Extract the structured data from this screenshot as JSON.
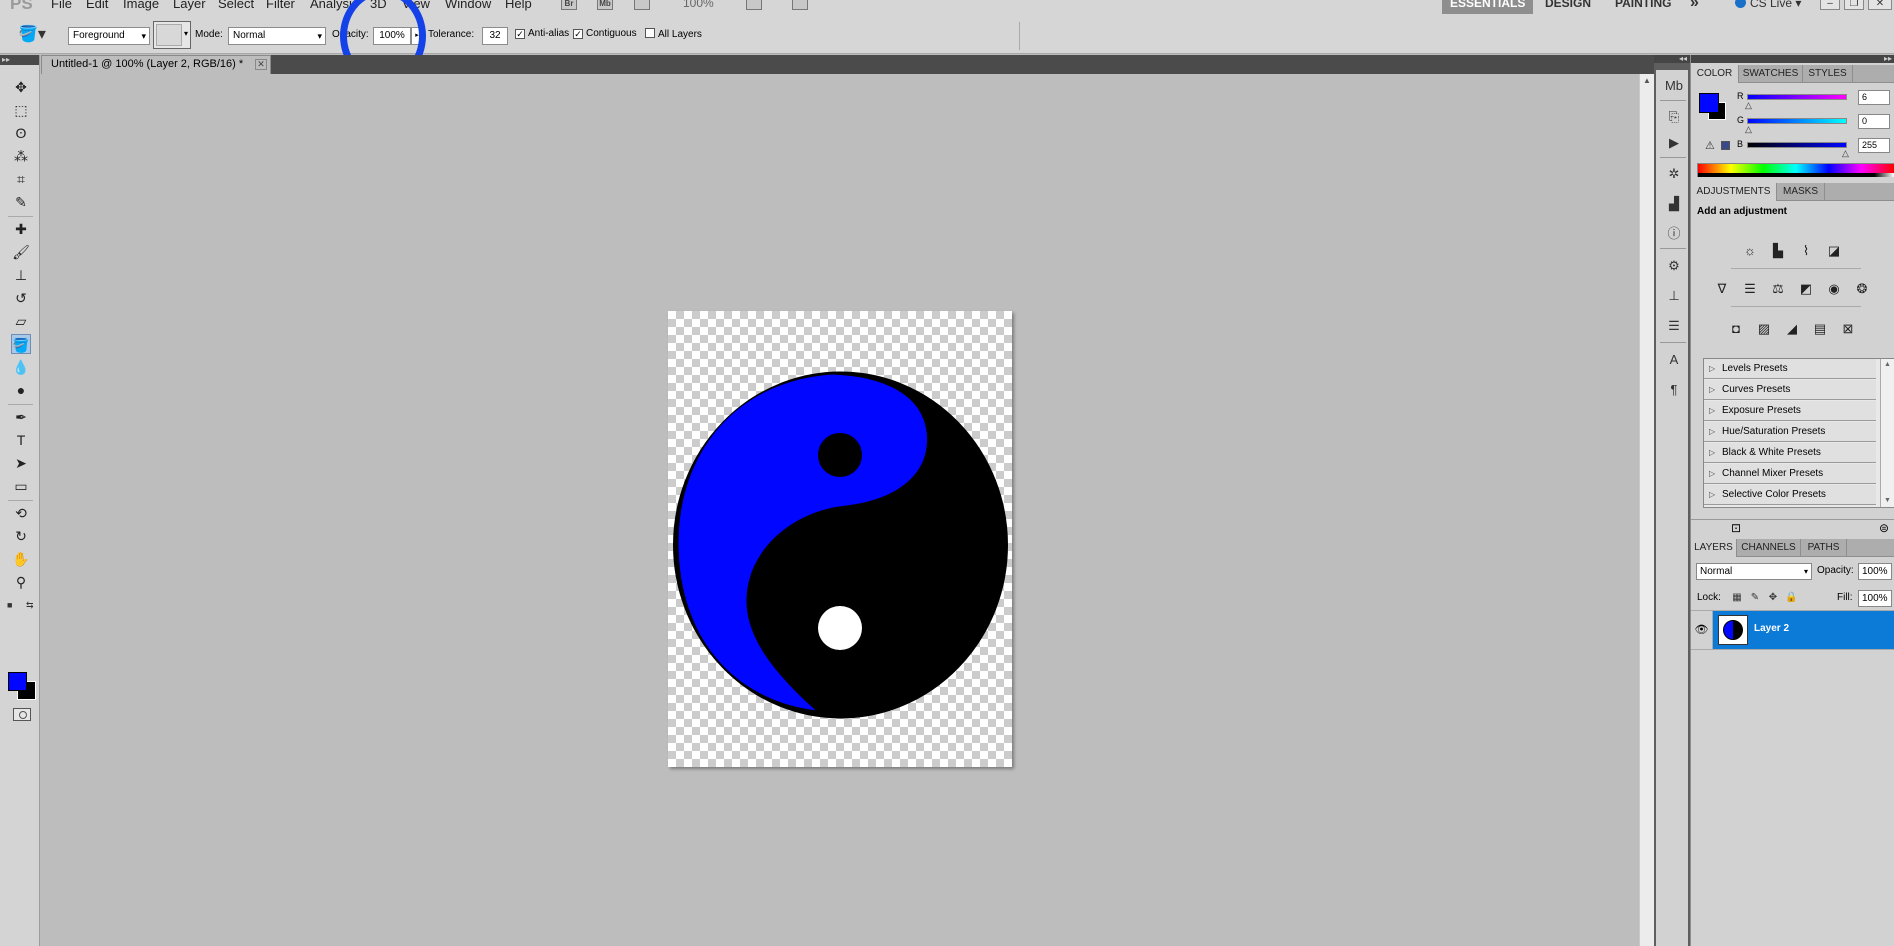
{
  "menubar": {
    "logo": "PS",
    "menus": [
      "File",
      "Edit",
      "Image",
      "Layer",
      "Select",
      "Filter",
      "Analysis",
      "3D",
      "View",
      "Window",
      "Help"
    ],
    "bridge_label": "Br",
    "minibridge_label": "Mb",
    "zoom": "100%",
    "workspaces": [
      "ESSENTIALS",
      "DESIGN",
      "PAINTING"
    ],
    "more": "»",
    "cs_live": "CS Live"
  },
  "options": {
    "fill_source": "Foreground",
    "mode_label": "Mode:",
    "mode_value": "Normal",
    "opacity_label": "Opacity:",
    "opacity_value": "100%",
    "tolerance_label": "Tolerance:",
    "tolerance_value": "32",
    "anti_alias": "Anti-alias",
    "contiguous": "Contiguous",
    "all_layers": "All Layers"
  },
  "document": {
    "tab_title": "Untitled-1 @ 100% (Layer 2, RGB/16) *",
    "colors": {
      "yang": "#0006ff",
      "yin": "#000000",
      "eye_light": "#ffffff"
    }
  },
  "color_panel": {
    "tabs": [
      "COLOR",
      "SWATCHES",
      "STYLES"
    ],
    "channels": [
      {
        "label": "R",
        "value": "6"
      },
      {
        "label": "G",
        "value": "0"
      },
      {
        "label": "B",
        "value": "255"
      }
    ],
    "foreground": "#0006ff",
    "background": "#000000"
  },
  "adjustments": {
    "tabs": [
      "ADJUSTMENTS",
      "MASKS"
    ],
    "title": "Add an adjustment",
    "presets": [
      "Levels Presets",
      "Curves Presets",
      "Exposure Presets",
      "Hue/Saturation Presets",
      "Black & White Presets",
      "Channel Mixer Presets",
      "Selective Color Presets"
    ]
  },
  "layers": {
    "tabs": [
      "LAYERS",
      "CHANNELS",
      "PATHS"
    ],
    "blend_mode": "Normal",
    "opacity_label": "Opacity:",
    "opacity_value": "100%",
    "lock_label": "Lock:",
    "fill_label": "Fill:",
    "fill_value": "100%",
    "items": [
      {
        "name": "Layer 2",
        "selected": true
      }
    ]
  },
  "accent_color": "#0c7bd8",
  "annotation_color": "#1442e8"
}
